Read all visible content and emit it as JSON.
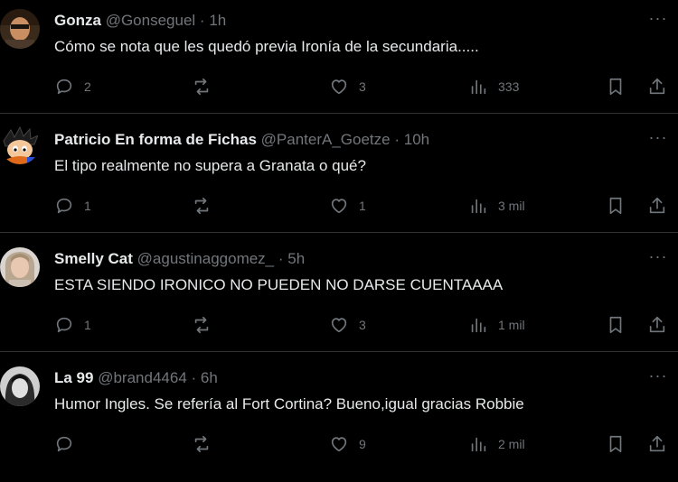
{
  "colors": {
    "background": "#000000",
    "text": "#e7e9ea",
    "muted": "#71767b",
    "divider": "#2f3336"
  },
  "icons": {
    "more": "more-horizontal-icon",
    "reply": "reply-bubble-icon",
    "retweet": "retweet-arrows-icon",
    "like": "heart-icon",
    "views": "bar-chart-icon",
    "bookmark": "bookmark-icon",
    "share": "share-upload-icon"
  },
  "tweets": [
    {
      "name": "Gonza",
      "handle": "@Gonseguel",
      "separator": "·",
      "time": "1h",
      "more": "···",
      "text": "Cómo se nota que les quedó previa Ironía de la secundaria.....",
      "replies": "2",
      "retweets": "",
      "likes": "3",
      "views": "333"
    },
    {
      "name": "Patricio En forma de Fichas",
      "handle": "@PanterA_Goetze",
      "separator": "·",
      "time": "10h",
      "more": "···",
      "text": "El tipo realmente no supera a Granata o qué?",
      "replies": "1",
      "retweets": "",
      "likes": "1",
      "views": "3 mil"
    },
    {
      "name": "Smelly Cat",
      "handle": "@agustinaggomez_",
      "separator": "·",
      "time": "5h",
      "more": "···",
      "text": "ESTA SIENDO IRONICO NO PUEDEN NO DARSE CUENTAAAA",
      "replies": "1",
      "retweets": "",
      "likes": "3",
      "views": "1 mil"
    },
    {
      "name": "La 99",
      "handle": "@brand4464",
      "separator": "·",
      "time": "6h",
      "more": "···",
      "text": "Humor Ingles. Se refería al Fort Cortina? Bueno,igual gracias Robbie",
      "replies": "",
      "retweets": "",
      "likes": "9",
      "views": "2 mil"
    }
  ]
}
